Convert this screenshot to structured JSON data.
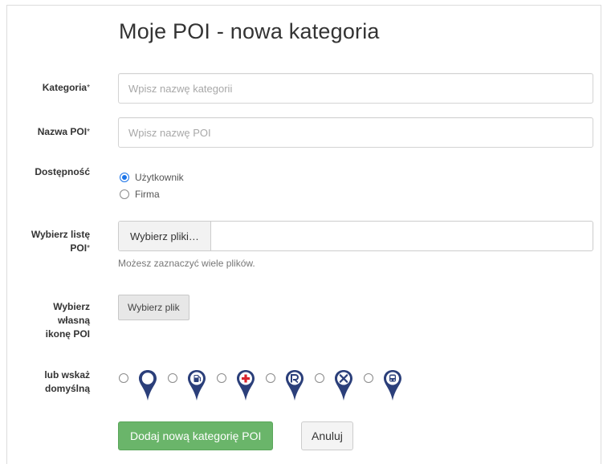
{
  "page": {
    "title": "Moje POI - nowa kategoria"
  },
  "form": {
    "category": {
      "label": "Kategoria",
      "required_mark": "*",
      "placeholder": "Wpisz nazwę kategorii",
      "value": ""
    },
    "poi_name": {
      "label": "Nazwa POI",
      "required_mark": "*",
      "placeholder": "Wpisz nazwę POI",
      "value": ""
    },
    "availability": {
      "label": "Dostępność",
      "options": [
        {
          "label": "Użytkownik",
          "checked": true
        },
        {
          "label": "Firma",
          "checked": false
        }
      ]
    },
    "poi_list": {
      "label_line1": "Wybierz listę",
      "label_line2": "POI",
      "required_mark": "*",
      "button_label": "Wybierz pliki…",
      "help_text": "Możesz zaznaczyć wiele plików."
    },
    "custom_icon": {
      "label_line1": "Wybierz",
      "label_line2": "własną",
      "label_line3": "ikonę POI",
      "button_label": "Wybierz plik"
    },
    "default_icon": {
      "label_line1": "lub wskaż",
      "label_line2": "domyślną",
      "icons": [
        {
          "name": "pin-empty-icon",
          "checked": false
        },
        {
          "name": "pin-fuel-icon",
          "checked": false
        },
        {
          "name": "pin-medical-icon",
          "checked": false
        },
        {
          "name": "pin-parking-icon",
          "checked": false
        },
        {
          "name": "pin-restaurant-icon",
          "checked": false
        },
        {
          "name": "pin-train-icon",
          "checked": false
        }
      ]
    }
  },
  "actions": {
    "submit_label": "Dodaj nową kategorię POI",
    "cancel_label": "Anuluj"
  },
  "colors": {
    "pin_blue": "#2b3f7a",
    "pin_white": "#ffffff",
    "medical_red": "#d9232d",
    "radio_checked": "#1a73e8",
    "primary_button": "#6ab56a"
  }
}
